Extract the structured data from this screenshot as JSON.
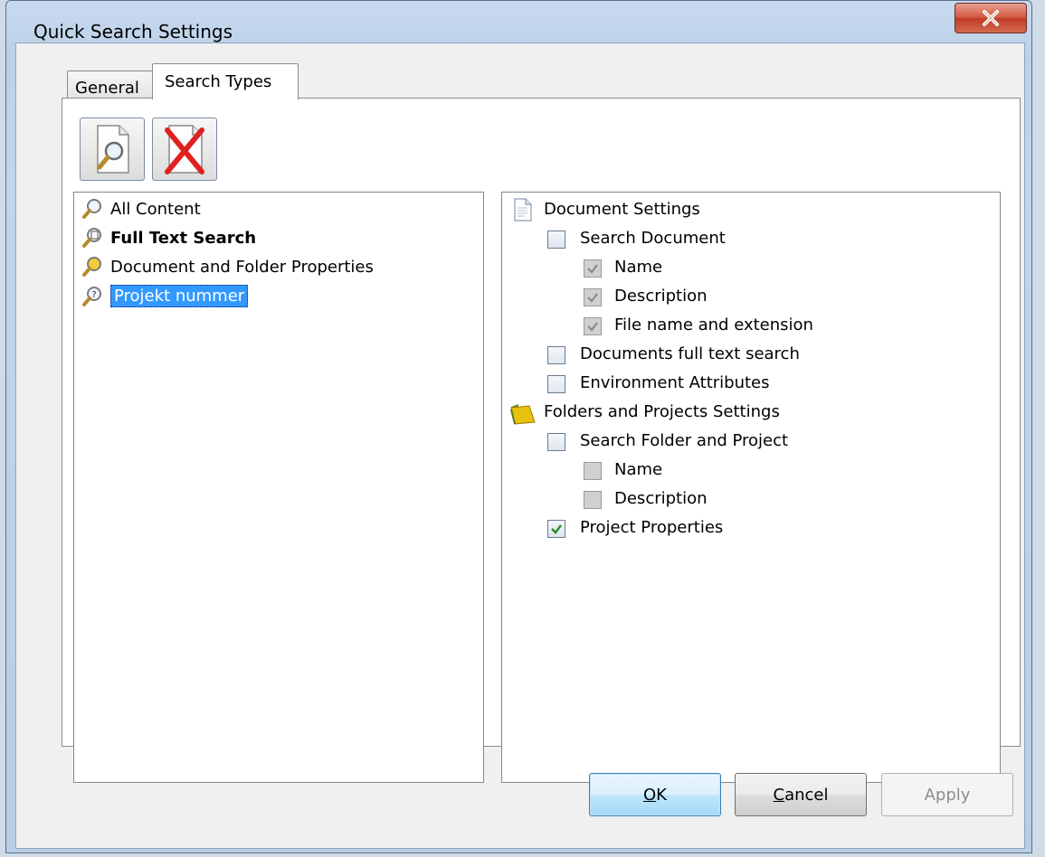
{
  "window": {
    "title": "Quick Search Settings",
    "close_label": "x"
  },
  "tabs": [
    {
      "label": "General",
      "active": false
    },
    {
      "label": "Search Types",
      "active": true
    }
  ],
  "toolbar": {
    "new_search_type": "new-search-type-icon",
    "delete_search_type": "delete-search-type-icon"
  },
  "search_types": [
    {
      "label": "All Content",
      "icon": "magnifier-icon",
      "bold": false,
      "selected": false
    },
    {
      "label": "Full Text Search",
      "icon": "magnifier-document-icon",
      "bold": true,
      "selected": false
    },
    {
      "label": "Document and Folder Properties",
      "icon": "magnifier-folder-icon",
      "bold": false,
      "selected": false
    },
    {
      "label": "Projekt nummer",
      "icon": "magnifier-question-icon",
      "bold": false,
      "selected": true
    }
  ],
  "settings": {
    "document_group": "Document Settings",
    "search_document": "Search Document",
    "doc_name": "Name",
    "doc_description": "Description",
    "doc_filename": "File name and extension",
    "docs_full_text": "Documents full text search",
    "env_attributes": "Environment Attributes",
    "folder_group": "Folders and Projects Settings",
    "search_folder": "Search Folder and Project",
    "folder_name": "Name",
    "folder_description": "Description",
    "project_properties": "Project Properties"
  },
  "buttons": {
    "ok_prefix": "",
    "ok_access": "O",
    "ok_rest": "K",
    "cancel_access": "C",
    "cancel_rest": "ancel",
    "apply": "Apply"
  },
  "colors": {
    "selection": "#3399ff",
    "check_green": "#2a8a2a",
    "close_red": "#c23a22"
  }
}
